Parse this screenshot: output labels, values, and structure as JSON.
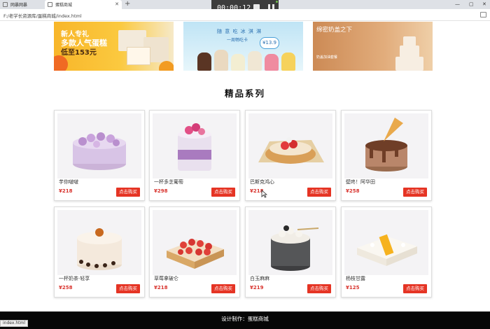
{
  "browser": {
    "tabs": [
      {
        "title": "网暴网暴",
        "active": false
      },
      {
        "title": "蛋糕商城",
        "active": true
      }
    ],
    "url": "F:/老学长资源库/蛋糕商城/index.html",
    "status_url": "index.html",
    "recorder_time": "00:00:12"
  },
  "banners": [
    {
      "line1": "新人专礼",
      "line2": "多款人气蛋糕",
      "line3": "低至153元"
    },
    {
      "line1": "随 意 吃 冰 淇 淋",
      "line2": "一周畅吃卡",
      "badge": "¥13.9"
    },
    {
      "line1": "绵密奶盖之下",
      "line2": "奶盖加油套餐"
    }
  ],
  "section_title": "精品系列",
  "buy_label": "点击购买",
  "products": [
    {
      "name": "芋你啵啵",
      "price": "¥218"
    },
    {
      "name": "一杯多芝葡萄",
      "price": "¥298"
    },
    {
      "name": "巴斯克鸿心",
      "price": "¥218"
    },
    {
      "name": "壁咚！阿华田",
      "price": "¥258"
    },
    {
      "name": "一杯奶茶·轻享",
      "price": "¥258"
    },
    {
      "name": "草莓拿破仑",
      "price": "¥218"
    },
    {
      "name": "白玉麻麻",
      "price": "¥219"
    },
    {
      "name": "杨枝甘露",
      "price": "¥125"
    }
  ],
  "footer": "设计制作：蛋糕商城"
}
